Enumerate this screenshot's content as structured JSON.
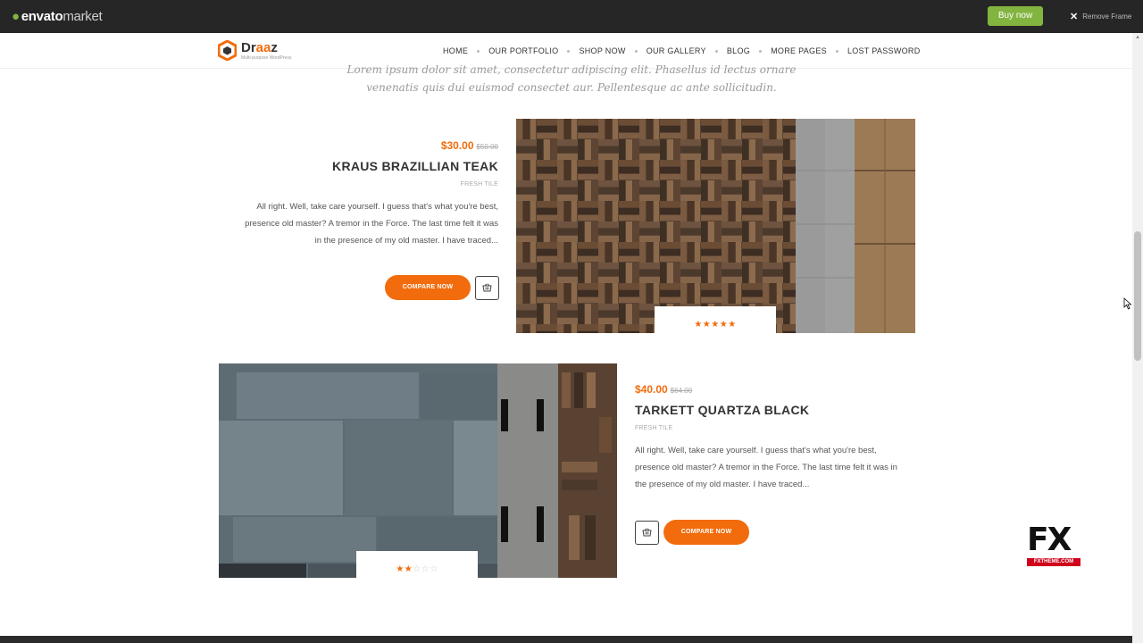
{
  "envato": {
    "logo_main": "envato",
    "logo_sub": "market",
    "buy_now": "Buy now",
    "remove_frame": "Remove Frame"
  },
  "brand": {
    "name_prefix": "Dr",
    "name_accent": "aa",
    "name_suffix": "z",
    "tagline": "Multi-purpose WordPress",
    "accent_color": "#f26c0d"
  },
  "nav": {
    "items": [
      "HOME",
      "OUR PORTFOLIO",
      "SHOP NOW",
      "OUR GALLERY",
      "BLOG",
      "MORE PAGES",
      "LOST PASSWORD"
    ]
  },
  "intro": {
    "line1": "Lorem ipsum dolor sit amet, consectetur adipiscing elit. Phasellus id lectus ornare",
    "line2": "venenatis quis dui euismod consectet aur. Pellentesque ac ante sollicitudin."
  },
  "products": [
    {
      "price": "$30.00",
      "old_price": "$50.00",
      "title": "KRAUS BRAZILLIAN TEAK",
      "category": "FRESH TILE",
      "description": "All right. Well, take care yourself. I guess that's what you're best, presence old master? A tremor in the Force. The last time felt it was in the presence of my old master. I have traced...",
      "button": "COMPARE NOW",
      "rating": 5,
      "stars_filled": "★★★★★",
      "stars_empty": ""
    },
    {
      "price": "$40.00",
      "old_price": "$64.00",
      "title": "TARKETT QUARTZA BLACK",
      "category": "FRESH TILE",
      "description": "All right. Well, take care yourself. I guess that's what you're best, presence old master? A tremor in the Force. The last time felt it was in the presence of my old master. I have traced...",
      "button": "COMPARE NOW",
      "rating": 2,
      "stars_filled": "★★",
      "stars_empty": "☆☆☆"
    }
  ],
  "fx_logo": {
    "letters": "FX",
    "site": "FXTHEME.COM"
  },
  "icons": {
    "basket": "basket-icon",
    "close": "close-icon",
    "leaf": "envato-leaf-icon",
    "brand": "hexagon-logo-icon",
    "cursor": "mouse-cursor-icon"
  }
}
